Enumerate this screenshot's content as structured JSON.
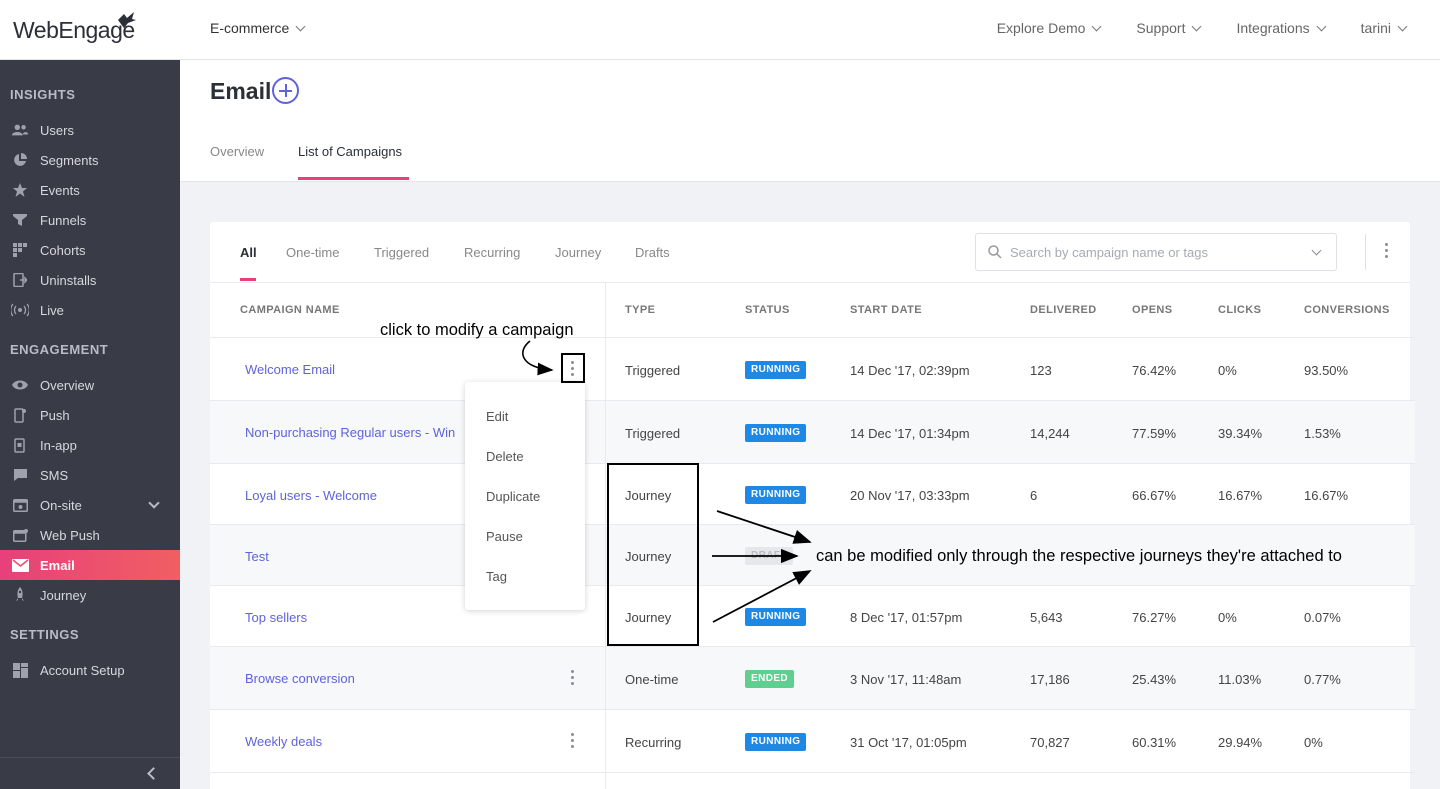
{
  "brand": {
    "logo_text": "WebEngage",
    "accent": "#e8407a",
    "link": "#5f63d8"
  },
  "header": {
    "project": "E-commerce",
    "nav": [
      "Explore Demo",
      "Support",
      "Integrations",
      "tarini"
    ]
  },
  "sidebar": {
    "sections": [
      {
        "title": "INSIGHTS",
        "items": [
          {
            "label": "Users",
            "icon": "users-icon"
          },
          {
            "label": "Segments",
            "icon": "pie-chart-icon"
          },
          {
            "label": "Events",
            "icon": "star-icon"
          },
          {
            "label": "Funnels",
            "icon": "funnel-icon"
          },
          {
            "label": "Cohorts",
            "icon": "grid-icon"
          },
          {
            "label": "Uninstalls",
            "icon": "uninstall-icon"
          },
          {
            "label": "Live",
            "icon": "live-signal-icon"
          }
        ]
      },
      {
        "title": "ENGAGEMENT",
        "items": [
          {
            "label": "Overview",
            "icon": "eye-icon"
          },
          {
            "label": "Push",
            "icon": "mobile-icon"
          },
          {
            "label": "In-app",
            "icon": "in-app-icon"
          },
          {
            "label": "SMS",
            "icon": "chat-icon"
          },
          {
            "label": "On-site",
            "icon": "browser-icon"
          },
          {
            "label": "Web Push",
            "icon": "web-push-icon"
          },
          {
            "label": "Email",
            "icon": "mail-icon",
            "active": true
          },
          {
            "label": "Journey",
            "icon": "rocket-icon"
          }
        ]
      },
      {
        "title": "SETTINGS",
        "items": [
          {
            "label": "Account Setup",
            "icon": "grid-settings-icon"
          }
        ]
      }
    ]
  },
  "page": {
    "title": "Email",
    "tabs": [
      "Overview",
      "List of Campaigns"
    ],
    "active_tab": "List of Campaigns"
  },
  "filters": {
    "tabs": [
      "All",
      "One-time",
      "Triggered",
      "Recurring",
      "Journey",
      "Drafts"
    ],
    "active": "All",
    "search_placeholder": "Search by campaign name or tags"
  },
  "table": {
    "columns": [
      "CAMPAIGN NAME",
      "TYPE",
      "STATUS",
      "START DATE",
      "DELIVERED",
      "OPENS",
      "CLICKS",
      "CONVERSIONS"
    ],
    "rows": [
      {
        "name": "Welcome Email",
        "type": "Triggered",
        "status": "RUNNING",
        "start": "14 Dec '17, 02:39pm",
        "delivered": "123",
        "opens": "76.42%",
        "clicks": "0%",
        "conversions": "93.50%"
      },
      {
        "name": "Non-purchasing Regular users - Win",
        "type": "Triggered",
        "status": "RUNNING",
        "start": "14 Dec '17, 01:34pm",
        "delivered": "14,244",
        "opens": "77.59%",
        "clicks": "39.34%",
        "conversions": "1.53%"
      },
      {
        "name": "Loyal users - Welcome",
        "type": "Journey",
        "status": "RUNNING",
        "start": "20 Nov '17, 03:33pm",
        "delivered": "6",
        "opens": "66.67%",
        "clicks": "16.67%",
        "conversions": "16.67%"
      },
      {
        "name": "Test",
        "type": "Journey",
        "status": "DRAFT",
        "start": "",
        "delivered": "",
        "opens": "",
        "clicks": "",
        "conversions": ""
      },
      {
        "name": "Top sellers",
        "type": "Journey",
        "status": "RUNNING",
        "start": "8 Dec '17, 01:57pm",
        "delivered": "5,643",
        "opens": "76.27%",
        "clicks": "0%",
        "conversions": "0.07%"
      },
      {
        "name": "Browse conversion",
        "type": "One-time",
        "status": "ENDED",
        "start": "3 Nov '17, 11:48am",
        "delivered": "17,186",
        "opens": "25.43%",
        "clicks": "11.03%",
        "conversions": "0.77%"
      },
      {
        "name": "Weekly deals",
        "type": "Recurring",
        "status": "RUNNING",
        "start": "31 Oct '17, 01:05pm",
        "delivered": "70,827",
        "opens": "60.31%",
        "clicks": "29.94%",
        "conversions": "0%"
      }
    ]
  },
  "menu": {
    "items": [
      "Edit",
      "Delete",
      "Duplicate",
      "Pause",
      "Tag"
    ]
  },
  "annotations": {
    "modify_hint": "click to modify a campaign",
    "journey_hint": "can be modified only through the respective journeys they're attached to"
  }
}
